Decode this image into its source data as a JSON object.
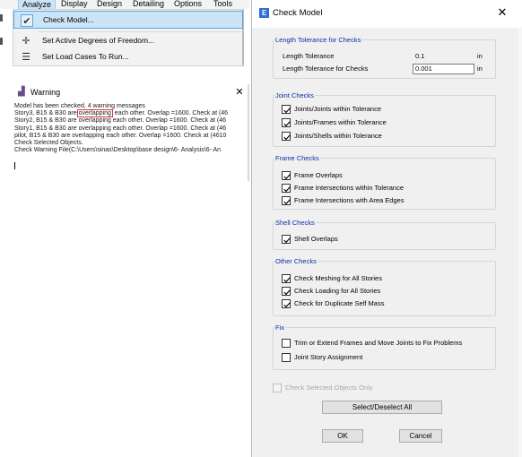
{
  "menubar": {
    "items": [
      "Analyze",
      "Display",
      "Design",
      "Detailing",
      "Options",
      "Tools"
    ]
  },
  "analyze_menu": {
    "items": [
      {
        "label": "Check Model...",
        "icon": "checkmark-icon"
      },
      {
        "label": "Set Active Degrees of Freedom...",
        "icon": "dof-axes-icon"
      },
      {
        "label": "Set Load Cases To Run...",
        "icon": "list-icon"
      }
    ]
  },
  "warning_window": {
    "title": "Warning",
    "lines": [
      "Model has been checked, 4 warning messages",
      "Story3, B15 & B30 are",
      "overlapping",
      " each other. Overlap =1600. Check at (46",
      "Story2, B15 & B30 are overlapping each other. Overlap =1600. Check at (46",
      "Story1, B15 & B30 are overlapping each other. Overlap =1600. Check at (46",
      "pilot, B15 & B30 are overlapping each other. Overlap =1600. Check at (4610",
      "Check Selected Objects.",
      "Check Warning File(C:\\Users\\sinas\\Desktop\\base design\\6- Analysis\\6- An"
    ]
  },
  "dialog": {
    "title": "Check Model",
    "icon_letter": "E",
    "length_tolerance": {
      "caption": "Length Tolerance for Checks",
      "row1_label": "Length Tolerance",
      "row1_value": "0.1",
      "row1_unit": "in",
      "row2_label": "Length Tolerance for Checks",
      "row2_value": "0.001",
      "row2_unit": "in"
    },
    "joint_checks": {
      "caption": "Joint Checks",
      "items": [
        {
          "label": "Joints/Joints within Tolerance",
          "checked": true
        },
        {
          "label": "Joints/Frames within Tolerance",
          "checked": true
        },
        {
          "label": "Joints/Shells within Tolerance",
          "checked": true
        }
      ]
    },
    "frame_checks": {
      "caption": "Frame Checks",
      "items": [
        {
          "label": "Frame Overlaps",
          "checked": true
        },
        {
          "label": "Frame Intersections within Tolerance",
          "checked": true
        },
        {
          "label": "Frame Intersections with Area Edges",
          "checked": true
        }
      ]
    },
    "shell_checks": {
      "caption": "Shell Checks",
      "items": [
        {
          "label": "Shell Overlaps",
          "checked": true
        }
      ]
    },
    "other_checks": {
      "caption": "Other Checks",
      "items": [
        {
          "label": "Check Meshing for All Stories",
          "checked": true
        },
        {
          "label": "Check Loading for All Stories",
          "checked": true
        },
        {
          "label": "Check for Duplicate Self Mass",
          "checked": true
        }
      ]
    },
    "fix": {
      "caption": "Fix",
      "items": [
        {
          "label": "Trim or Extend Frames and Move Joints to Fix Problems",
          "checked": false
        },
        {
          "label": "Joint Story Assignment",
          "checked": false
        }
      ]
    },
    "check_selected_only": {
      "label": "Check Selected Objects Only",
      "checked": false,
      "enabled": false
    },
    "select_deselect_label": "Select/Deselect All",
    "ok_label": "OK",
    "cancel_label": "Cancel",
    "colors": {
      "caption": "#0a2ea6",
      "highlight": "#cce4f7"
    }
  }
}
